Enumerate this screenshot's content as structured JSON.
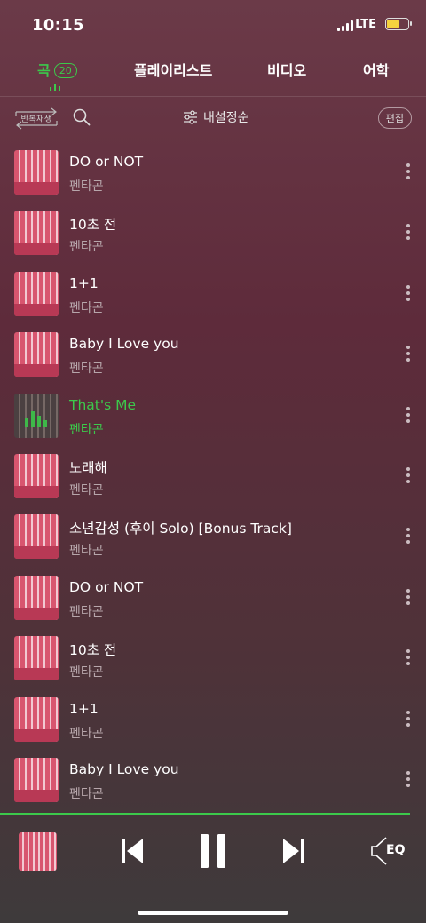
{
  "status": {
    "time": "10:15",
    "network": "LTE"
  },
  "tabs": [
    {
      "label": "곡",
      "badge": "20"
    },
    {
      "label": "플레이리스트"
    },
    {
      "label": "비디오"
    },
    {
      "label": "어학"
    }
  ],
  "toolbar": {
    "repeat_label": "반복재생",
    "sort_label": "내설정순",
    "edit_label": "편집"
  },
  "songs": [
    {
      "title": "DO or NOT",
      "artist": "펜타곤"
    },
    {
      "title": "10초 전",
      "artist": "펜타곤"
    },
    {
      "title": "1+1",
      "artist": "펜타곤"
    },
    {
      "title": "Baby I Love you",
      "artist": "펜타곤"
    },
    {
      "title": "That's Me",
      "artist": "펜타곤",
      "playing": true
    },
    {
      "title": "노래해",
      "artist": "펜타곤"
    },
    {
      "title": "소년감성 (후이 Solo) [Bonus Track]",
      "artist": "펜타곤"
    },
    {
      "title": "DO or NOT",
      "artist": "펜타곤"
    },
    {
      "title": "10초 전",
      "artist": "펜타곤"
    },
    {
      "title": "1+1",
      "artist": "펜타곤"
    },
    {
      "title": "Baby I Love you",
      "artist": "펜타곤"
    }
  ],
  "player": {
    "eq_label": "EQ",
    "state": "playing"
  },
  "colors": {
    "accent": "#3cc94b"
  }
}
